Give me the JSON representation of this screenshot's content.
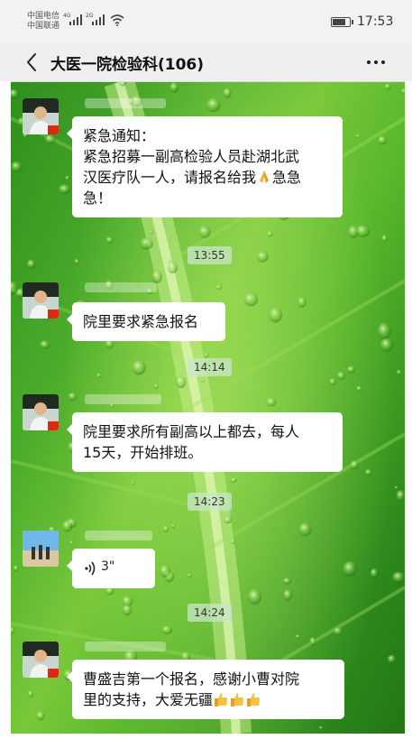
{
  "status_bar": {
    "carrier_1": "中国电信",
    "carrier_2": "中国联通",
    "net_1": "4G",
    "net_2": "2G",
    "battery_level": 0.8,
    "time": "17:53"
  },
  "nav": {
    "back_icon": "chevron-left-icon",
    "title": "大医一院检验科(106)",
    "more_icon": "more-dots-icon"
  },
  "messages": [
    {
      "type": "text",
      "lines": [
        "紧急通知：",
        "紧急招募一副高检验人员赴湖北武",
        "汉医疗队一人，请报名给我",
        "急！"
      ],
      "inline_emoji": "folded-hands-emoji",
      "inline_emoji_text": "急急"
    },
    {
      "type": "text",
      "lines": [
        "院里要求紧急报名"
      ]
    },
    {
      "type": "text",
      "lines": [
        "院里要求所有副高以上都去，每人",
        "15天，开始排班。"
      ]
    },
    {
      "type": "voice",
      "duration": "3\""
    },
    {
      "type": "text",
      "lines": [
        "曹盛吉第一个报名，感谢小曹对院",
        "里的支持，大爱无疆"
      ],
      "trailing_emoji": "thumbs-up-emoji"
    }
  ],
  "timestamps": [
    "13:55",
    "14:14",
    "14:23",
    "14:24"
  ]
}
